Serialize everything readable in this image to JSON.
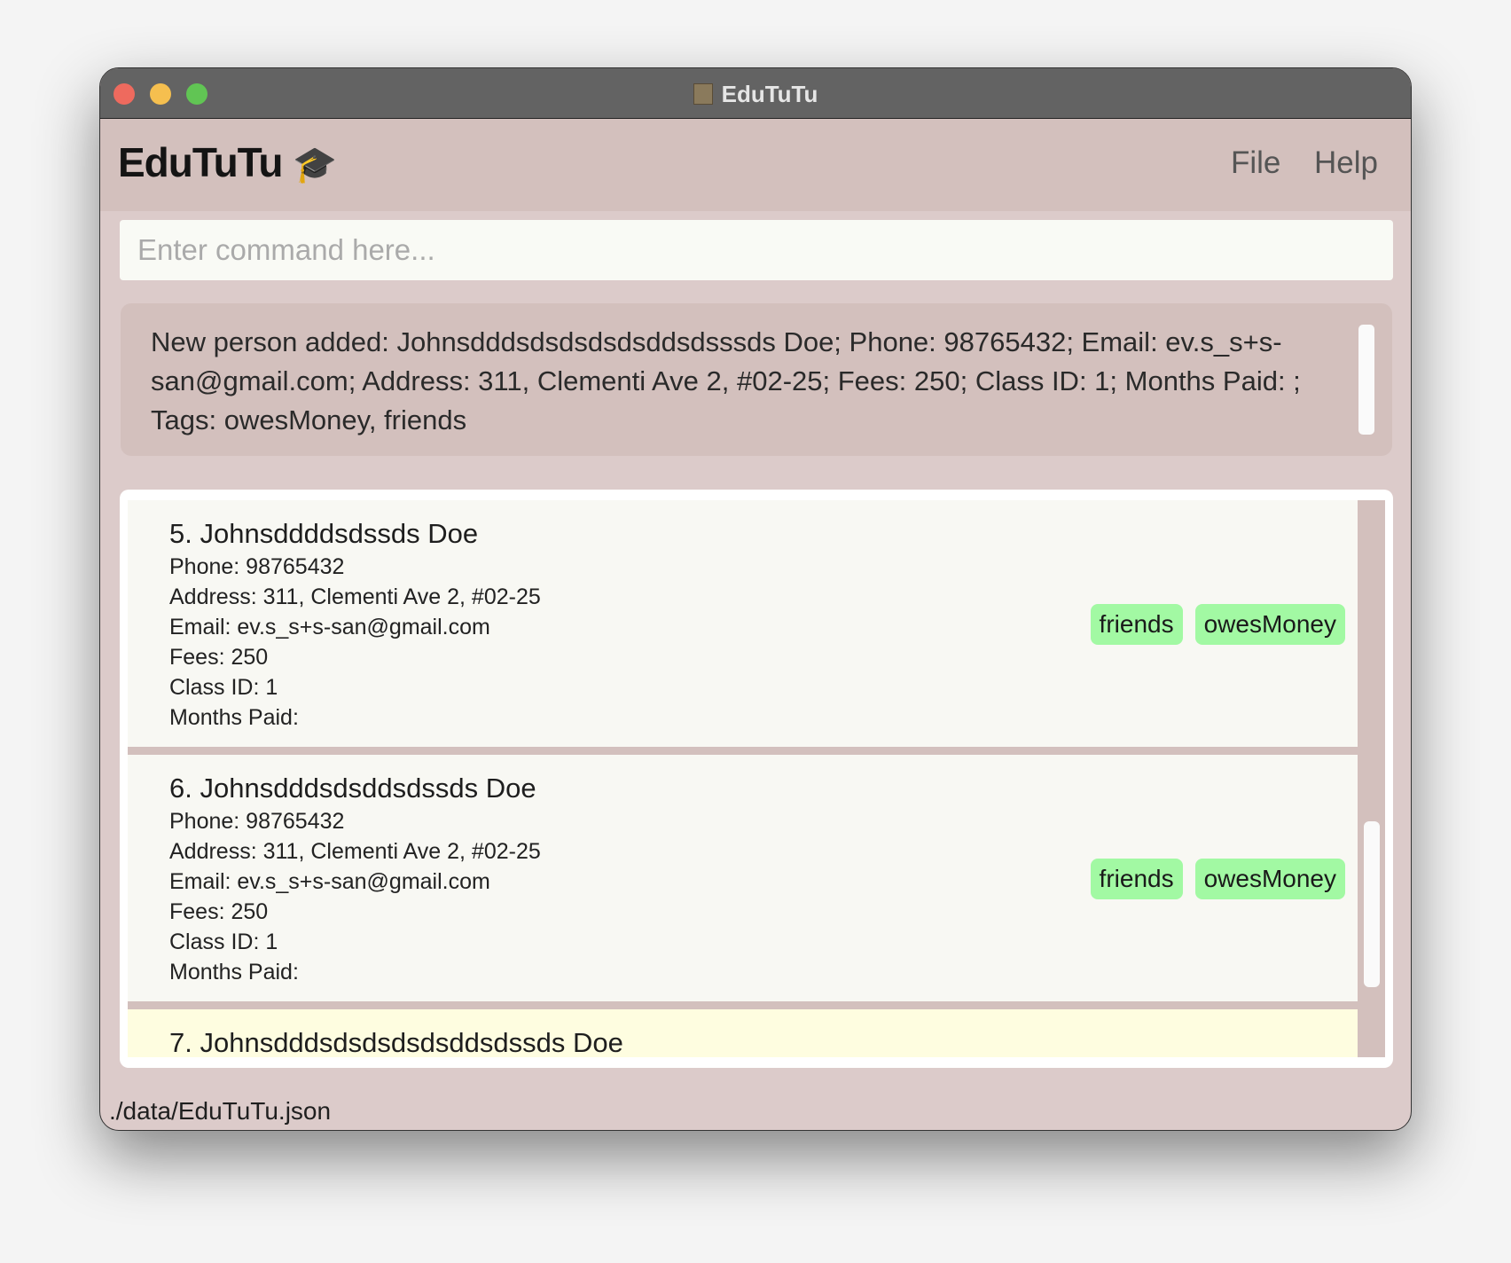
{
  "window": {
    "title": "EduTuTu",
    "app_icon": "contacts-book-icon"
  },
  "header": {
    "brand": "EduTuTu",
    "brand_icon": "graduation-cap-icon",
    "menu": [
      "File",
      "Help"
    ]
  },
  "command": {
    "placeholder": "Enter command here...",
    "value": ""
  },
  "result": {
    "text": "New person added: Johnsdddsdsdsdsdsddsdsssds Doe; Phone: 98765432; Email: ev.s_s+s-san@gmail.com; Address: 311, Clementi Ave 2, #02-25; Fees: 250; Class ID: 1; Months Paid: ; Tags: owesMoney, friends"
  },
  "persons": [
    {
      "name": "5. Johnsddddsdssds Doe",
      "phone": "Phone:  98765432",
      "address": "Address:  311, Clementi Ave 2, #02-25",
      "email": "Email:  ev.s_s+s-san@gmail.com",
      "fees": "Fees:  250",
      "class_id": "Class ID:  1",
      "months_paid": "Months Paid:",
      "tags": [
        "friends",
        "owesMoney"
      ]
    },
    {
      "name": "6. Johnsdddsdsddsdssds Doe",
      "phone": "Phone:  98765432",
      "address": "Address:  311, Clementi Ave 2, #02-25",
      "email": "Email:  ev.s_s+s-san@gmail.com",
      "fees": "Fees:  250",
      "class_id": "Class ID:  1",
      "months_paid": "Months Paid:",
      "tags": [
        "friends",
        "owesMoney"
      ]
    },
    {
      "name": "7. Johnsdddsdsdsdsdsddsdssds Doe"
    }
  ],
  "status": {
    "path": "./data/EduTuTu.json"
  },
  "colors": {
    "header": "#d3c0bd",
    "panel": "#dccbca",
    "tag": "#a2f9a3",
    "selected": "#fefde0"
  }
}
